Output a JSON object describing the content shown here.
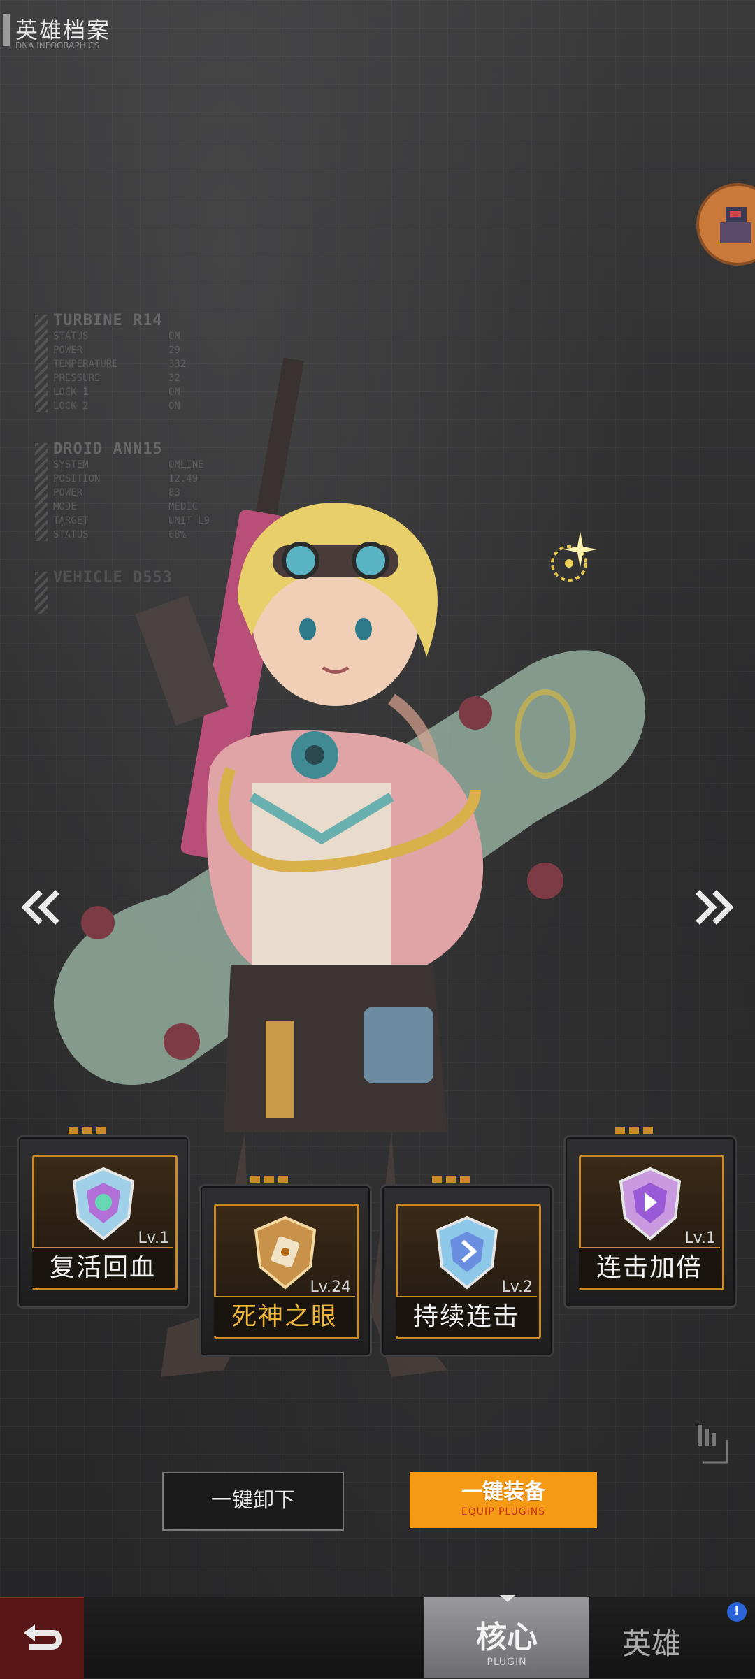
{
  "header": {
    "title": "英雄档案",
    "subtitle": "DNA INFOGRAPHICS"
  },
  "panels": [
    {
      "heading": "TURBINE R14",
      "rows": [
        {
          "key": "STATUS",
          "value": "ON"
        },
        {
          "key": "POWER",
          "value": "29"
        },
        {
          "key": "TEMPERATURE",
          "value": "332"
        },
        {
          "key": "PRESSURE",
          "value": "32"
        },
        {
          "key": "LOCK 1",
          "value": "ON"
        },
        {
          "key": "LOCK 2",
          "value": "ON"
        }
      ]
    },
    {
      "heading": "DROID ANN15",
      "rows": [
        {
          "key": "SYSTEM",
          "value": "ONLINE"
        },
        {
          "key": "POSITION",
          "value": "12.49"
        },
        {
          "key": "POWER",
          "value": "83"
        },
        {
          "key": "MODE",
          "value": "MEDIC"
        },
        {
          "key": "TARGET",
          "value": "UNIT L9"
        },
        {
          "key": "STATUS",
          "value": "68%"
        }
      ]
    },
    {
      "heading": "VEHICLE D553",
      "rows": []
    }
  ],
  "plugins": [
    {
      "name": "复活回血",
      "level": "Lv.1"
    },
    {
      "name": "死神之眼",
      "level": "Lv.24"
    },
    {
      "name": "持续连击",
      "level": "Lv.2"
    },
    {
      "name": "连击加倍",
      "level": "Lv.1"
    }
  ],
  "buttons": {
    "unequip_label": "一键卸下",
    "equip_label": "一键装备",
    "equip_sub": "EQUIP PLUGINS"
  },
  "bottom_nav": {
    "core_label": "核心",
    "core_sub": "PLUGIN",
    "hero_label": "英雄",
    "badge": "!"
  },
  "icons": [
    "back-arrow-icon",
    "chevron-left-icon",
    "chevron-right-icon",
    "sparkle-icon",
    "plugin-emblem-icon"
  ],
  "colors": {
    "accent": "#f59a14",
    "card_border": "#c88a2a",
    "back_button": "#5a1718",
    "badge": "#2b63d9"
  }
}
